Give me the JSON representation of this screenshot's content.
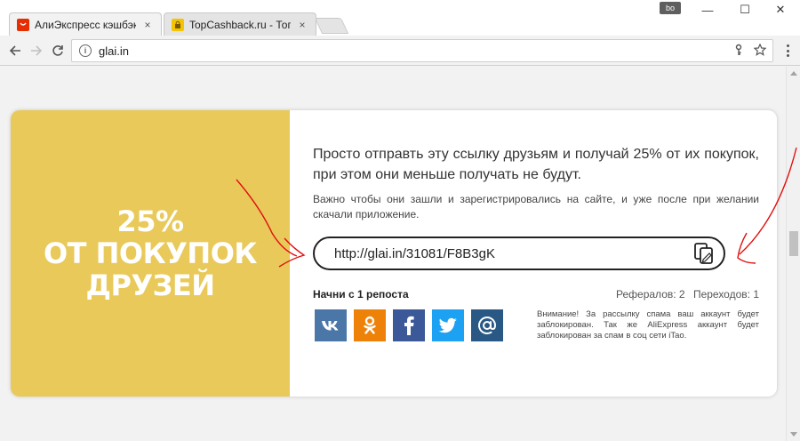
{
  "browser": {
    "tabs": [
      {
        "title": "АлиЭкспресс кэшбэк",
        "favicon_color": "#e62e04",
        "active": true
      },
      {
        "title": "TopCashback.ru - Топ лу",
        "favicon_color": "#f5c400",
        "active": false
      }
    ],
    "profile_badge": "bo",
    "window_controls": {
      "minimize": "—",
      "maximize": "☐",
      "close": "✕"
    },
    "address": "glai.in",
    "close_glyph": "×"
  },
  "page": {
    "promo": {
      "percent": "25%",
      "line1": "ОТ ПОКУПОК",
      "line2": "ДРУЗЕЙ",
      "background": "#e8c95a"
    },
    "headline": "Просто отправть эту ссылку друзьям и получай 25% от их покупок, при этом они меньше получать не будут.",
    "subtext": "Важно чтобы они зашли и зарегистрировались на сайте, и уже после при желании скачали приложение.",
    "referral_link": "http://glai.in/31081/F8B3gK",
    "share_label": "Начни с 1 репоста",
    "stats": {
      "referrals": "Рефералов: 2",
      "clicks": "Переходов: 1"
    },
    "socials": [
      {
        "name": "vk",
        "glyph": "vk",
        "color": "#4a76a8"
      },
      {
        "name": "odnoklassniki",
        "glyph": "ok",
        "color": "#ee8208"
      },
      {
        "name": "facebook",
        "glyph": "f",
        "color": "#3b5998"
      },
      {
        "name": "twitter",
        "glyph": "t",
        "color": "#1da1f2"
      },
      {
        "name": "email",
        "glyph": "@",
        "color": "#2a5885"
      }
    ],
    "warning": "Внимание! За рассылку спама ваш аккаунт будет заблокирован. Так же AliExpress аккаунт будет заблокирован за спам в соц сети iTao."
  },
  "annotation_color": "#e01010"
}
